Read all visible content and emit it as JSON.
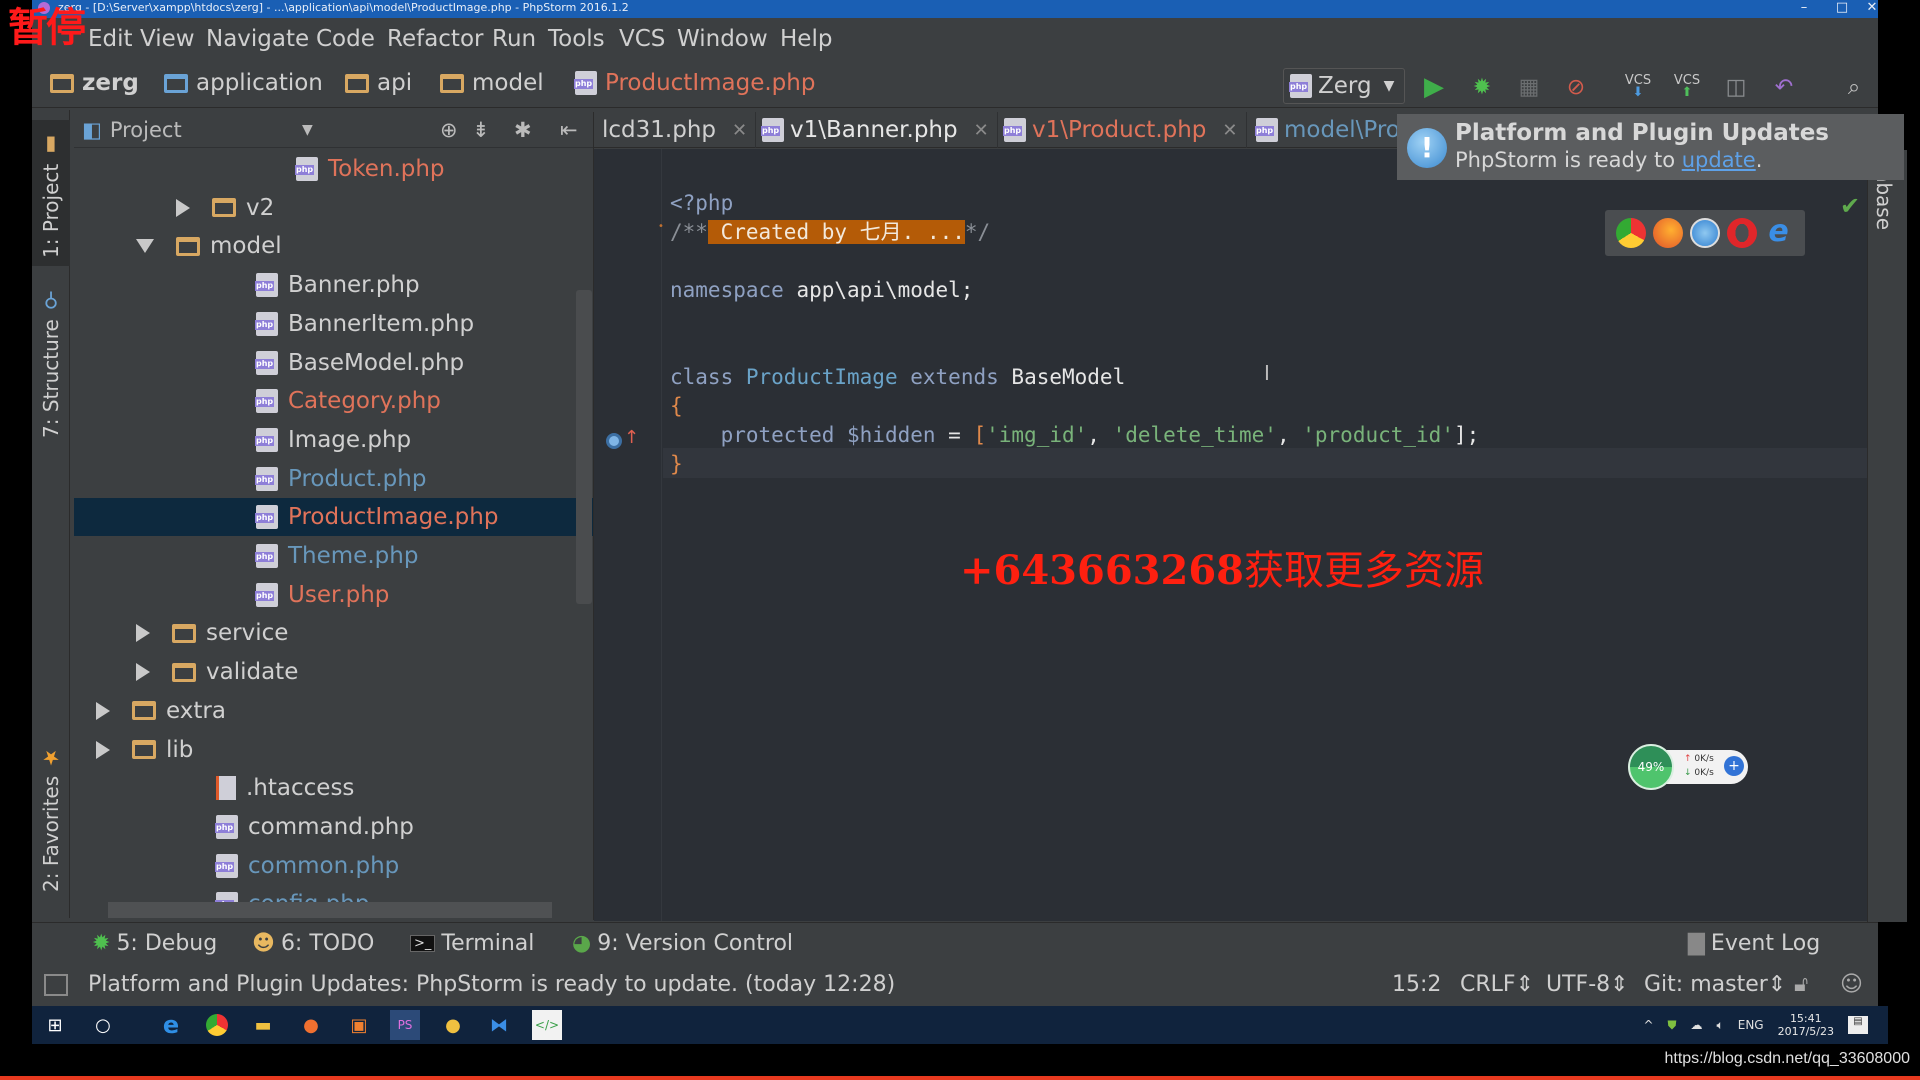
{
  "overlay": {
    "pause_label": "暂停",
    "watermark_number": "+643663268",
    "watermark_text": "获取更多资源",
    "source_url": "https://blog.csdn.net/qq_33608000"
  },
  "window": {
    "title": "zerg - [D:\\Server\\xampp\\htdocs\\zerg] - ...\\application\\api\\model\\ProductImage.php - PhpStorm 2016.1.2",
    "controls": {
      "minimize": "–",
      "maximize": "□",
      "close": "✕"
    }
  },
  "menu": [
    "Edit",
    "View",
    "Navigate",
    "Code",
    "Refactor",
    "Run",
    "Tools",
    "VCS",
    "Window",
    "Help"
  ],
  "breadcrumb": [
    {
      "label": "zerg",
      "icon": "folder-icon"
    },
    {
      "label": "application",
      "icon": "source-folder-icon"
    },
    {
      "label": "api",
      "icon": "folder-icon"
    },
    {
      "label": "model",
      "icon": "folder-icon"
    },
    {
      "label": "ProductImage.php",
      "icon": "php-file-icon"
    }
  ],
  "toolbar": {
    "run_config": "Zerg",
    "icons": [
      "run-icon",
      "debug-icon",
      "coverage-icon",
      "stop-debug-icon",
      "vcs-update-icon",
      "vcs-commit-icon",
      "history-icon",
      "revert-icon",
      "search-icon"
    ],
    "vcs_label": "VCS"
  },
  "left_strip": {
    "tabs": [
      "1: Project",
      "7: Structure",
      "2: Favorites"
    ]
  },
  "project_panel": {
    "header": "Project",
    "tree": [
      {
        "label": "Token.php",
        "type": "php",
        "color": "red",
        "indent": 6
      },
      {
        "label": "v2",
        "type": "folder",
        "expand": "right",
        "indent": 4
      },
      {
        "label": "model",
        "type": "folder",
        "expand": "down",
        "indent": 3
      },
      {
        "label": "Banner.php",
        "type": "php",
        "color": "default",
        "indent": 5
      },
      {
        "label": "BannerItem.php",
        "type": "php",
        "color": "default",
        "indent": 5
      },
      {
        "label": "BaseModel.php",
        "type": "php",
        "color": "default",
        "indent": 5
      },
      {
        "label": "Category.php",
        "type": "php",
        "color": "red",
        "indent": 5
      },
      {
        "label": "Image.php",
        "type": "php",
        "color": "default",
        "indent": 5
      },
      {
        "label": "Product.php",
        "type": "php",
        "color": "blue",
        "indent": 5
      },
      {
        "label": "ProductImage.php",
        "type": "php",
        "color": "red",
        "indent": 5,
        "selected": true
      },
      {
        "label": "Theme.php",
        "type": "php",
        "color": "blue",
        "indent": 5
      },
      {
        "label": "User.php",
        "type": "php",
        "color": "red",
        "indent": 5
      },
      {
        "label": "service",
        "type": "folder",
        "expand": "right",
        "indent": 3
      },
      {
        "label": "validate",
        "type": "folder",
        "expand": "right",
        "indent": 3
      },
      {
        "label": "extra",
        "type": "folder",
        "expand": "right",
        "indent": 2
      },
      {
        "label": "lib",
        "type": "folder",
        "expand": "right",
        "indent": 2
      },
      {
        "label": ".htaccess",
        "type": "htaccess",
        "color": "default",
        "indent": 4
      },
      {
        "label": "command.php",
        "type": "php",
        "color": "default",
        "indent": 4
      },
      {
        "label": "common.php",
        "type": "php",
        "color": "blue",
        "indent": 4
      },
      {
        "label": "config.php",
        "type": "php",
        "color": "blue",
        "indent": 4
      }
    ]
  },
  "editor_tabs": [
    {
      "label": "lcd31.php",
      "color": "default",
      "closable": true
    },
    {
      "label": "v1\\Banner.php",
      "color": "default",
      "closable": true
    },
    {
      "label": "v1\\Product.php",
      "color": "red",
      "closable": true
    },
    {
      "label": "model\\Pro",
      "color": "blue",
      "closable": false
    }
  ],
  "code": {
    "line1": "<?php",
    "line2_open": "/**",
    "line2_comment": " Created by 七月. ...",
    "line2_close": "*/",
    "ns_kw": "namespace",
    "ns_name": " app\\api\\model;",
    "class_kw": "class",
    "class_name": "ProductImage",
    "extends_kw": "extends",
    "parent": "BaseModel",
    "open_brace": "{",
    "prop_kw": "protected",
    "prop_var": " $hidden",
    "prop_eq": " = ",
    "prop_open": "[",
    "str1": "'img_id'",
    "str2": "'delete_time'",
    "str3": "'product_id'",
    "sep": ", ",
    "prop_close": "];",
    "close_brace": "}"
  },
  "notification": {
    "title": "Platform and Plugin Updates",
    "message_prefix": "PhpStorm is ready to ",
    "link": "update",
    "message_suffix": "."
  },
  "browsers": [
    "chrome-icon",
    "firefox-icon",
    "safari-icon",
    "opera-icon",
    "ie-icon"
  ],
  "right_strip": {
    "tab": "atabase"
  },
  "net_widget": {
    "percent": "49%",
    "up": "0K/s",
    "down": "0K/s"
  },
  "tool_windows": [
    {
      "label": "5: Debug",
      "icon": "debug-icon"
    },
    {
      "label": "6: TODO",
      "icon": "todo-icon"
    },
    {
      "label": "Terminal",
      "icon": "terminal-icon"
    },
    {
      "label": "9: Version Control",
      "icon": "version-control-icon"
    }
  ],
  "event_log": "Event Log",
  "status": {
    "message": "Platform and Plugin Updates: PhpStorm is ready to update. (today 12:28)",
    "position": "15:2",
    "line_sep": "CRLF",
    "encoding": "UTF-8",
    "vcs_branch": "Git: master"
  },
  "taskbar": {
    "apps": [
      "windows-start-icon",
      "cortana-icon",
      "edge-icon",
      "chrome-icon",
      "file-explorer-icon",
      "postman-icon",
      "xampp-icon",
      "phpstorm-icon",
      "navicat-icon",
      "vscode-icon",
      "code-editor-icon"
    ],
    "tray_lang": "ENG",
    "time": "15:41",
    "date": "2017/5/23"
  }
}
